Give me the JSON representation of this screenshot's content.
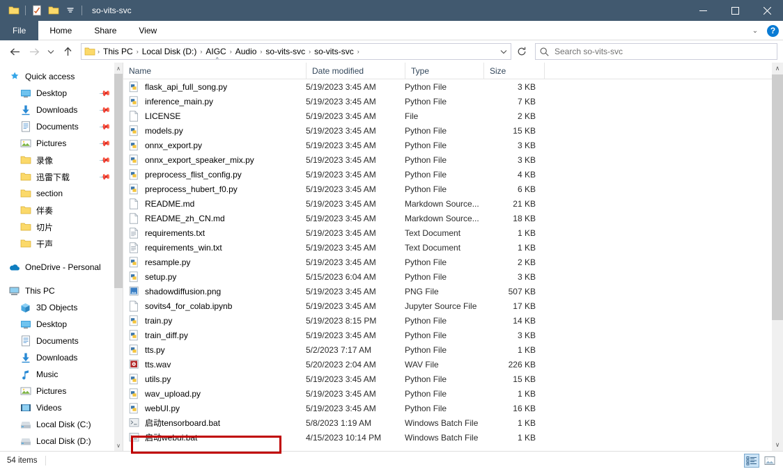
{
  "window": {
    "title": "so-vits-svc",
    "quick_access": [
      "folder-icon",
      "properties-icon",
      "new-folder-icon",
      "customize-dropdown-icon"
    ],
    "minimize_label": "—",
    "maximize_label": "☐",
    "close_label": "✕"
  },
  "ribbon": {
    "tabs": [
      {
        "label": "File",
        "id": "file"
      },
      {
        "label": "Home",
        "id": "home"
      },
      {
        "label": "Share",
        "id": "share"
      },
      {
        "label": "View",
        "id": "view"
      }
    ],
    "expand_label": "⌄",
    "help_label": "?"
  },
  "address": {
    "back_label": "←",
    "forward_label": "→",
    "recent_label": "⌄",
    "up_label": "↑",
    "breadcrumbs": [
      "This PC",
      "Local Disk (D:)",
      "AIGC",
      "Audio",
      "so-vits-svc",
      "so-vits-svc"
    ],
    "separator": "›",
    "dropdown_label": "⌄",
    "refresh_label": "↻"
  },
  "search": {
    "placeholder": "Search so-vits-svc",
    "icon": "search-icon"
  },
  "sidebar": {
    "groups": [
      {
        "header": {
          "label": "Quick access",
          "icon": "star-pin-icon"
        },
        "items": [
          {
            "label": "Desktop",
            "icon": "desktop-icon",
            "pinned": true
          },
          {
            "label": "Downloads",
            "icon": "downloads-icon",
            "pinned": true
          },
          {
            "label": "Documents",
            "icon": "documents-icon",
            "pinned": true
          },
          {
            "label": "Pictures",
            "icon": "pictures-icon",
            "pinned": true
          },
          {
            "label": "录像",
            "icon": "folder-icon",
            "pinned": true
          },
          {
            "label": "迅雷下载",
            "icon": "folder-icon",
            "pinned": true
          },
          {
            "label": "section",
            "icon": "folder-icon",
            "pinned": false
          },
          {
            "label": "伴奏",
            "icon": "folder-icon",
            "pinned": false
          },
          {
            "label": "切片",
            "icon": "folder-icon",
            "pinned": false
          },
          {
            "label": "干声",
            "icon": "folder-icon",
            "pinned": false
          }
        ]
      },
      {
        "header": {
          "label": "OneDrive - Personal",
          "icon": "onedrive-icon"
        },
        "items": []
      },
      {
        "header": {
          "label": "This PC",
          "icon": "this-pc-icon"
        },
        "items": [
          {
            "label": "3D Objects",
            "icon": "3d-objects-icon",
            "pinned": false
          },
          {
            "label": "Desktop",
            "icon": "desktop-icon",
            "pinned": false
          },
          {
            "label": "Documents",
            "icon": "documents-icon",
            "pinned": false
          },
          {
            "label": "Downloads",
            "icon": "downloads-icon",
            "pinned": false
          },
          {
            "label": "Music",
            "icon": "music-icon",
            "pinned": false
          },
          {
            "label": "Pictures",
            "icon": "pictures-icon",
            "pinned": false
          },
          {
            "label": "Videos",
            "icon": "videos-icon",
            "pinned": false
          },
          {
            "label": "Local Disk (C:)",
            "icon": "drive-icon",
            "pinned": false
          },
          {
            "label": "Local Disk (D:)",
            "icon": "drive-icon",
            "pinned": false
          }
        ]
      }
    ],
    "scroll_up": "∧",
    "scroll_down": "∨"
  },
  "filelist": {
    "columns": [
      {
        "label": "Name",
        "sorted": true,
        "sort_caret": "⌃"
      },
      {
        "label": "Date modified",
        "sorted": false
      },
      {
        "label": "Type",
        "sorted": false
      },
      {
        "label": "Size",
        "sorted": false
      }
    ],
    "rows": [
      {
        "name": "flask_api_full_song.py",
        "date": "5/19/2023 3:45 AM",
        "type": "Python File",
        "size": "3 KB",
        "icon": "python-file-icon"
      },
      {
        "name": "inference_main.py",
        "date": "5/19/2023 3:45 AM",
        "type": "Python File",
        "size": "7 KB",
        "icon": "python-file-icon"
      },
      {
        "name": "LICENSE",
        "date": "5/19/2023 3:45 AM",
        "type": "File",
        "size": "2 KB",
        "icon": "blank-file-icon"
      },
      {
        "name": "models.py",
        "date": "5/19/2023 3:45 AM",
        "type": "Python File",
        "size": "15 KB",
        "icon": "python-file-icon"
      },
      {
        "name": "onnx_export.py",
        "date": "5/19/2023 3:45 AM",
        "type": "Python File",
        "size": "3 KB",
        "icon": "python-file-icon"
      },
      {
        "name": "onnx_export_speaker_mix.py",
        "date": "5/19/2023 3:45 AM",
        "type": "Python File",
        "size": "3 KB",
        "icon": "python-file-icon"
      },
      {
        "name": "preprocess_flist_config.py",
        "date": "5/19/2023 3:45 AM",
        "type": "Python File",
        "size": "4 KB",
        "icon": "python-file-icon"
      },
      {
        "name": "preprocess_hubert_f0.py",
        "date": "5/19/2023 3:45 AM",
        "type": "Python File",
        "size": "6 KB",
        "icon": "python-file-icon"
      },
      {
        "name": "README.md",
        "date": "5/19/2023 3:45 AM",
        "type": "Markdown Source...",
        "size": "21 KB",
        "icon": "blank-file-icon"
      },
      {
        "name": "README_zh_CN.md",
        "date": "5/19/2023 3:45 AM",
        "type": "Markdown Source...",
        "size": "18 KB",
        "icon": "blank-file-icon"
      },
      {
        "name": "requirements.txt",
        "date": "5/19/2023 3:45 AM",
        "type": "Text Document",
        "size": "1 KB",
        "icon": "text-file-icon"
      },
      {
        "name": "requirements_win.txt",
        "date": "5/19/2023 3:45 AM",
        "type": "Text Document",
        "size": "1 KB",
        "icon": "text-file-icon"
      },
      {
        "name": "resample.py",
        "date": "5/19/2023 3:45 AM",
        "type": "Python File",
        "size": "2 KB",
        "icon": "python-file-icon"
      },
      {
        "name": "setup.py",
        "date": "5/15/2023 6:04 AM",
        "type": "Python File",
        "size": "3 KB",
        "icon": "python-file-icon"
      },
      {
        "name": "shadowdiffusion.png",
        "date": "5/19/2023 3:45 AM",
        "type": "PNG File",
        "size": "507 KB",
        "icon": "png-file-icon"
      },
      {
        "name": "sovits4_for_colab.ipynb",
        "date": "5/19/2023 3:45 AM",
        "type": "Jupyter Source File",
        "size": "17 KB",
        "icon": "blank-file-icon"
      },
      {
        "name": "train.py",
        "date": "5/19/2023 8:15 PM",
        "type": "Python File",
        "size": "14 KB",
        "icon": "python-file-icon"
      },
      {
        "name": "train_diff.py",
        "date": "5/19/2023 3:45 AM",
        "type": "Python File",
        "size": "3 KB",
        "icon": "python-file-icon"
      },
      {
        "name": "tts.py",
        "date": "5/2/2023 7:17 AM",
        "type": "Python File",
        "size": "1 KB",
        "icon": "python-file-icon"
      },
      {
        "name": "tts.wav",
        "date": "5/20/2023 2:04 AM",
        "type": "WAV File",
        "size": "226 KB",
        "icon": "wav-file-icon"
      },
      {
        "name": "utils.py",
        "date": "5/19/2023 3:45 AM",
        "type": "Python File",
        "size": "15 KB",
        "icon": "python-file-icon"
      },
      {
        "name": "wav_upload.py",
        "date": "5/19/2023 3:45 AM",
        "type": "Python File",
        "size": "1 KB",
        "icon": "python-file-icon"
      },
      {
        "name": "webUI.py",
        "date": "5/19/2023 3:45 AM",
        "type": "Python File",
        "size": "16 KB",
        "icon": "python-file-icon"
      },
      {
        "name": "启动tensorboard.bat",
        "date": "5/8/2023 1:19 AM",
        "type": "Windows Batch File",
        "size": "1 KB",
        "icon": "bat-file-icon"
      },
      {
        "name": "启动webui.bat",
        "date": "4/15/2023 10:14 PM",
        "type": "Windows Batch File",
        "size": "1 KB",
        "icon": "bat-file-icon",
        "highlighted": true
      }
    ],
    "scroll_up": "∧",
    "scroll_down": "∨"
  },
  "statusbar": {
    "item_count": "54 items",
    "view_buttons": [
      {
        "name": "details-view-button",
        "icon": "details-view-icon",
        "active": true
      },
      {
        "name": "large-icons-view-button",
        "icon": "large-icons-view-icon",
        "active": false
      }
    ]
  },
  "annotation": {
    "color": "#c00000",
    "target": "启动webui.bat"
  },
  "layout": {
    "col_x": {
      "name": 8,
      "date": 270,
      "type": 412,
      "size": 525,
      "end": 612
    }
  }
}
